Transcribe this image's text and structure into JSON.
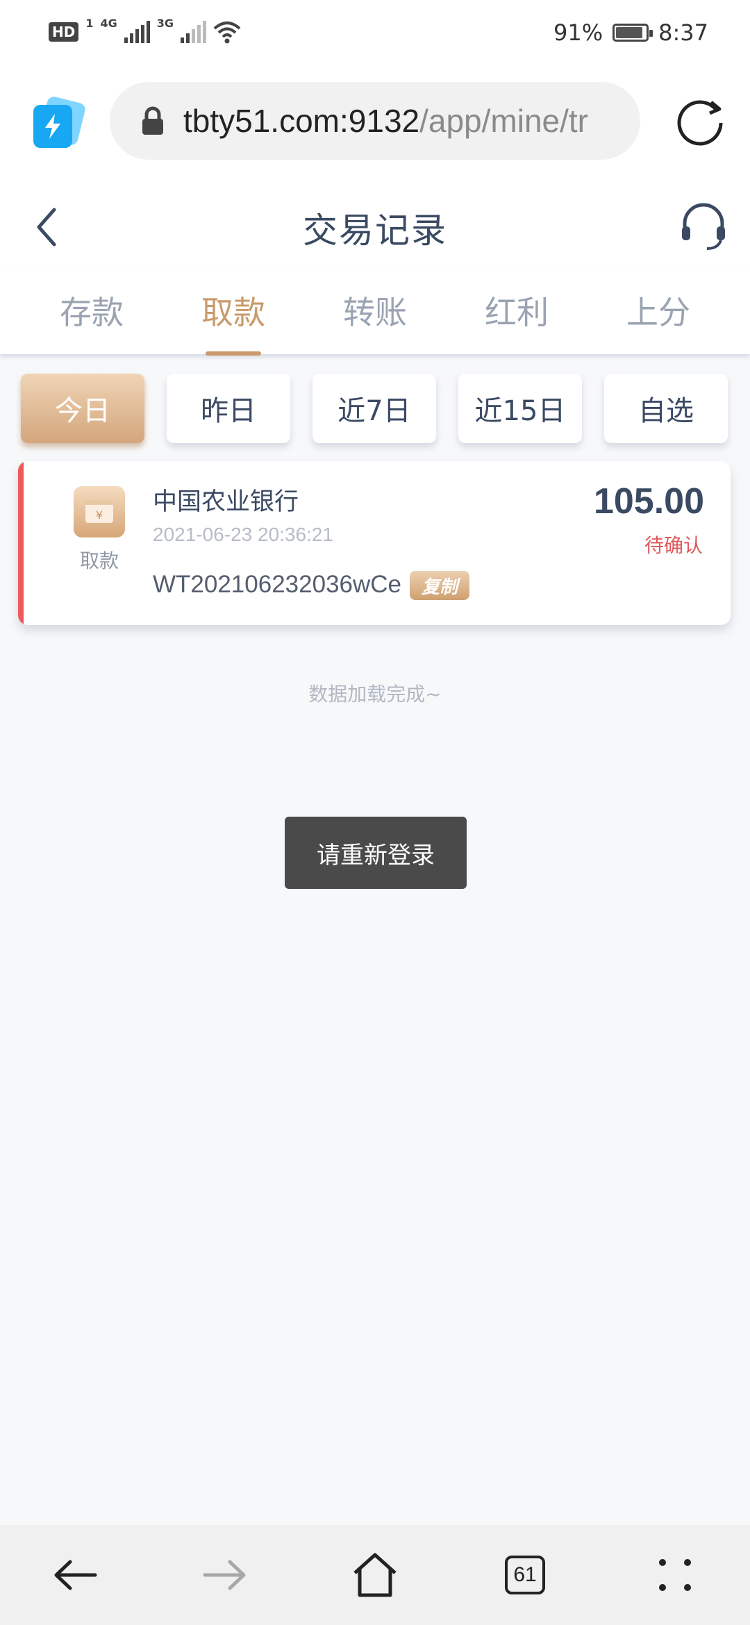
{
  "status_bar": {
    "hd_label": "HD",
    "sim1_label": "1",
    "net1": "4G",
    "net2": "3G",
    "battery_percent": "91%",
    "battery_level": 0.91,
    "time": "8:37"
  },
  "browser": {
    "url_host": "tbty51.com:9132",
    "url_path": "/app/mine/tr",
    "tab_count": "61"
  },
  "header": {
    "title": "交易记录"
  },
  "tabs": [
    {
      "label": "存款",
      "active": false
    },
    {
      "label": "取款",
      "active": true
    },
    {
      "label": "转账",
      "active": false
    },
    {
      "label": "红利",
      "active": false
    },
    {
      "label": "上分",
      "active": false
    }
  ],
  "filters": [
    {
      "label": "今日",
      "active": true
    },
    {
      "label": "昨日",
      "active": false
    },
    {
      "label": "近7日",
      "active": false
    },
    {
      "label": "近15日",
      "active": false
    },
    {
      "label": "自选",
      "active": false
    }
  ],
  "record": {
    "type_label": "取款",
    "bank": "中国农业银行",
    "datetime": "2021-06-23 20:36:21",
    "order_no": "WT202106232036wCe",
    "copy_label": "复制",
    "amount": "105.00",
    "status": "待确认"
  },
  "load_status": "数据加载完成~",
  "toast": "请重新登录",
  "colors": {
    "accent_gold": "#c99a6b",
    "title_navy": "#3b4a63",
    "status_red": "#e0575a",
    "record_stripe": "#ee5a5a"
  }
}
